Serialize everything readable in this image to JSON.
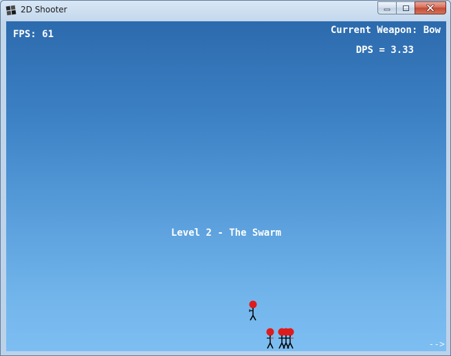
{
  "window": {
    "title": "2D Shooter",
    "icons": {
      "app": "app-icon",
      "minimize": "minimize-icon",
      "maximize": "maximize-icon",
      "close": "close-icon"
    }
  },
  "hud": {
    "fps": "FPS: 61",
    "weapon": "Current Weapon: Bow",
    "dps": "DPS = 3.33",
    "level": "Level 2 - The Swarm",
    "next": "-->"
  },
  "enemies": {
    "count": 5,
    "head_color": "#e01b1b",
    "body_color": "#000000"
  },
  "colors": {
    "sky_top": "#2c6aad",
    "sky_bottom": "#7dbef2",
    "hud_text": "#ffffff"
  }
}
